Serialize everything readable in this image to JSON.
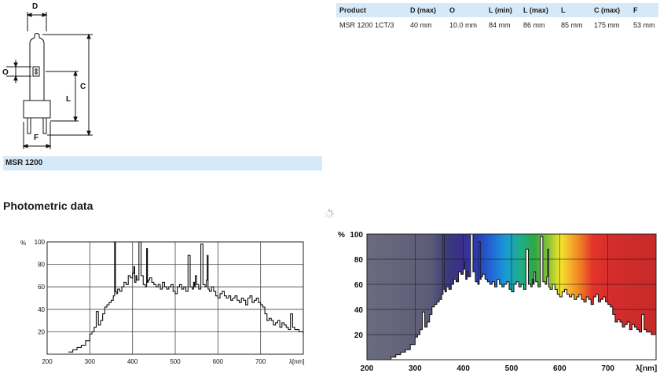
{
  "drawing": {
    "labels": {
      "d": "D",
      "o": "O",
      "l": "L",
      "c": "C",
      "f": "F"
    }
  },
  "spec_table": {
    "headers": [
      "Product",
      "D (max)",
      "O",
      "L (min)",
      "L (max)",
      "L",
      "C (max)",
      "F"
    ],
    "rows": [
      [
        "MSR 1200 1CT/3",
        "40 mm",
        "10.0 mm",
        "84 mm",
        "86 mm",
        "85 mm",
        "175 mm",
        "53 mm"
      ]
    ]
  },
  "product_bar": {
    "label": "MSR 1200"
  },
  "section": {
    "title": "Photometric data"
  },
  "colors": {
    "table_header_bg": "#d6e9f8",
    "curve_fill": "#ffffff",
    "spectrum_mask": "#ffffff"
  },
  "chart_data": [
    {
      "type": "line",
      "title": "",
      "y_axis_symbol": "%",
      "x_unit": "λ[nm]",
      "xlim": [
        200,
        800
      ],
      "ylim": [
        0,
        100
      ],
      "x_ticks": [
        "200",
        "300",
        "400",
        "500",
        "600",
        "700"
      ],
      "y_ticks": [
        "20",
        "40",
        "60",
        "80",
        "100"
      ],
      "grid": true,
      "x": [
        250,
        260,
        270,
        280,
        290,
        300,
        305,
        310,
        315,
        320,
        325,
        330,
        335,
        340,
        345,
        350,
        355,
        358,
        360,
        362,
        365,
        370,
        375,
        380,
        385,
        390,
        395,
        400,
        403,
        405,
        408,
        410,
        415,
        420,
        425,
        430,
        433,
        435,
        437,
        440,
        445,
        450,
        455,
        460,
        465,
        470,
        475,
        480,
        485,
        490,
        495,
        500,
        505,
        510,
        515,
        520,
        525,
        530,
        535,
        540,
        543,
        545,
        547,
        550,
        555,
        560,
        565,
        570,
        573,
        575,
        577,
        580,
        585,
        590,
        595,
        600,
        605,
        610,
        615,
        620,
        625,
        630,
        635,
        640,
        645,
        650,
        655,
        660,
        665,
        670,
        675,
        680,
        685,
        690,
        695,
        700,
        705,
        710,
        715,
        720,
        725,
        730,
        735,
        740,
        745,
        750,
        755,
        760,
        765,
        770,
        775,
        780,
        790,
        800
      ],
      "values": [
        2,
        4,
        6,
        8,
        12,
        18,
        20,
        24,
        38,
        26,
        30,
        36,
        42,
        44,
        46,
        48,
        52,
        100,
        56,
        54,
        58,
        56,
        60,
        64,
        62,
        70,
        68,
        72,
        78,
        64,
        70,
        66,
        100,
        70,
        62,
        60,
        94,
        64,
        66,
        68,
        64,
        62,
        60,
        62,
        58,
        64,
        60,
        58,
        60,
        62,
        56,
        54,
        60,
        62,
        58,
        60,
        56,
        88,
        60,
        58,
        64,
        60,
        70,
        62,
        58,
        98,
        62,
        60,
        66,
        88,
        58,
        56,
        60,
        56,
        52,
        50,
        54,
        56,
        52,
        50,
        52,
        48,
        50,
        52,
        48,
        46,
        50,
        48,
        44,
        50,
        52,
        46,
        48,
        50,
        46,
        44,
        42,
        36,
        30,
        32,
        30,
        26,
        28,
        30,
        24,
        28,
        26,
        24,
        22,
        36,
        24,
        22,
        20,
        18
      ]
    },
    {
      "type": "area",
      "title": "",
      "y_axis_symbol": "%",
      "x_unit": "λ[nm]",
      "xlim": [
        200,
        800
      ],
      "ylim": [
        0,
        100
      ],
      "x_ticks": [
        "200",
        "300",
        "400",
        "500",
        "600",
        "700"
      ],
      "y_ticks": [
        "20",
        "40",
        "60",
        "80",
        "100"
      ],
      "grid": true,
      "background": "visible-spectrum gradient",
      "x": [
        250,
        260,
        270,
        280,
        290,
        300,
        305,
        310,
        315,
        320,
        325,
        330,
        335,
        340,
        345,
        350,
        355,
        358,
        360,
        362,
        365,
        370,
        375,
        380,
        385,
        390,
        395,
        400,
        403,
        405,
        408,
        410,
        415,
        420,
        425,
        430,
        433,
        435,
        437,
        440,
        445,
        450,
        455,
        460,
        465,
        470,
        475,
        480,
        485,
        490,
        495,
        500,
        505,
        510,
        515,
        520,
        525,
        530,
        535,
        540,
        543,
        545,
        547,
        550,
        555,
        560,
        565,
        570,
        573,
        575,
        577,
        580,
        585,
        590,
        595,
        600,
        605,
        610,
        615,
        620,
        625,
        630,
        635,
        640,
        645,
        650,
        655,
        660,
        665,
        670,
        675,
        680,
        685,
        690,
        695,
        700,
        705,
        710,
        715,
        720,
        725,
        730,
        735,
        740,
        745,
        750,
        755,
        760,
        765,
        770,
        775,
        780,
        790,
        800
      ],
      "values": [
        2,
        4,
        6,
        8,
        12,
        18,
        20,
        24,
        38,
        26,
        30,
        36,
        42,
        44,
        46,
        48,
        52,
        100,
        56,
        54,
        58,
        56,
        60,
        64,
        62,
        70,
        68,
        72,
        78,
        64,
        70,
        66,
        100,
        70,
        62,
        60,
        94,
        64,
        66,
        68,
        64,
        62,
        60,
        62,
        58,
        64,
        60,
        58,
        60,
        62,
        56,
        54,
        60,
        62,
        58,
        60,
        56,
        88,
        60,
        58,
        64,
        60,
        70,
        62,
        58,
        98,
        62,
        60,
        66,
        88,
        58,
        56,
        60,
        56,
        52,
        50,
        54,
        56,
        52,
        50,
        52,
        48,
        50,
        52,
        48,
        46,
        50,
        48,
        44,
        50,
        52,
        46,
        48,
        50,
        46,
        44,
        42,
        36,
        30,
        32,
        30,
        26,
        28,
        30,
        24,
        28,
        26,
        24,
        22,
        36,
        24,
        22,
        20,
        18
      ]
    }
  ]
}
